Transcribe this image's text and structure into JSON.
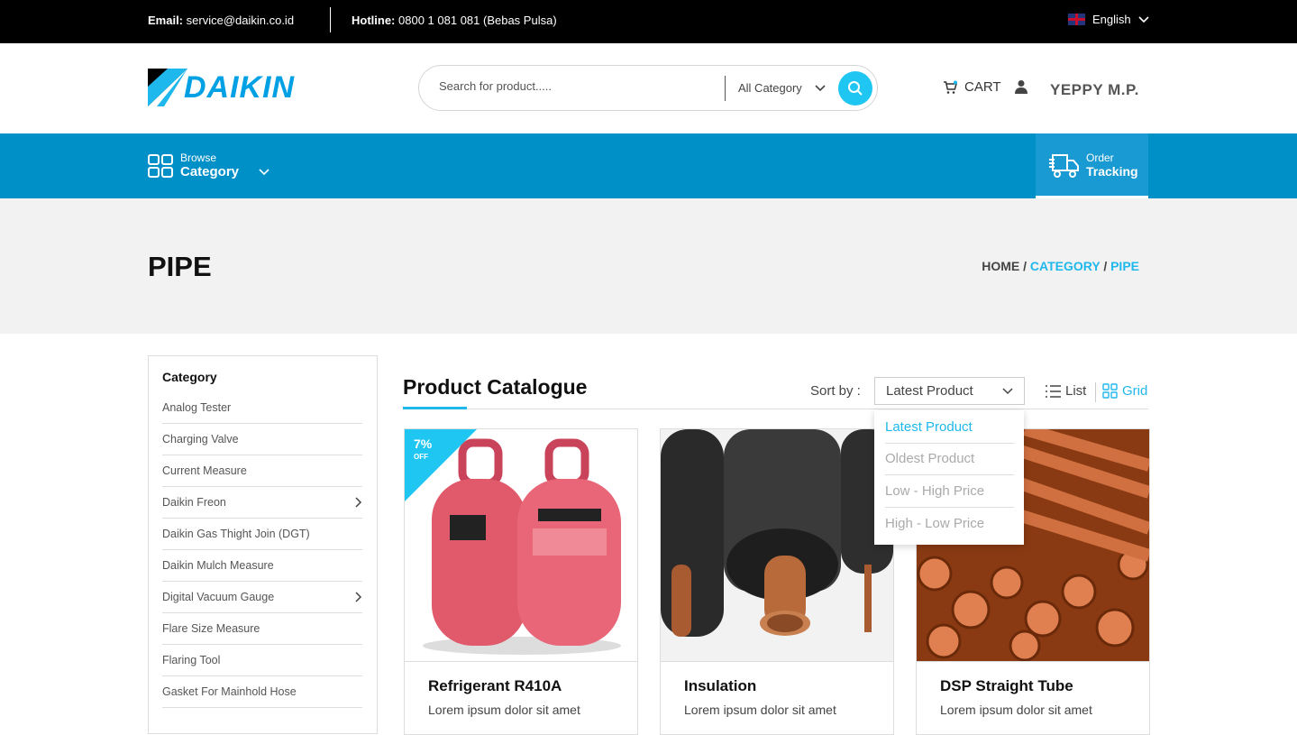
{
  "topbar": {
    "email_label": "Email:",
    "email_value": "service@daikin.co.id",
    "hotline_label": "Hotline:",
    "hotline_value": "0800 1 081 081 (Bebas Pulsa)",
    "language": "English"
  },
  "header": {
    "logo_text": "DAIKIN",
    "search_placeholder": "Search for product.....",
    "category_select": "All Category",
    "cart_label": "CART",
    "username": "YEPPY M.P."
  },
  "nav": {
    "browse_small": "Browse",
    "browse_big": "Category",
    "tracking_small": "Order",
    "tracking_big": "Tracking"
  },
  "page": {
    "title": "PIPE",
    "breadcrumb": {
      "home": "HOME",
      "sep": "/",
      "category": "CATEGORY",
      "current": "PIPE"
    }
  },
  "sidebar": {
    "title": "Category",
    "items": [
      {
        "label": "Analog Tester",
        "has_children": false
      },
      {
        "label": "Charging Valve",
        "has_children": false
      },
      {
        "label": "Current Measure",
        "has_children": false
      },
      {
        "label": "Daikin Freon",
        "has_children": true
      },
      {
        "label": "Daikin Gas Thight Join (DGT)",
        "has_children": false
      },
      {
        "label": "Daikin Mulch Measure",
        "has_children": false
      },
      {
        "label": "Digital Vacuum Gauge",
        "has_children": true
      },
      {
        "label": "Flare Size Measure",
        "has_children": false
      },
      {
        "label": "Flaring Tool",
        "has_children": false
      },
      {
        "label": "Gasket For Mainhold Hose",
        "has_children": false
      }
    ]
  },
  "catalogue": {
    "title": "Product Catalogue",
    "sort_label": "Sort by :",
    "sort_selected": "Latest Product",
    "view_list": "List",
    "view_grid": "Grid",
    "sort_options": [
      "Latest Product",
      "Oldest Product",
      "Low - High Price",
      "High - Low Price"
    ]
  },
  "products": [
    {
      "name": "Refrigerant R410A",
      "desc": "Lorem ipsum dolor sit amet",
      "badge_pct": "7%",
      "badge_off": "OFF"
    },
    {
      "name": "Insulation",
      "desc": "Lorem ipsum dolor sit amet"
    },
    {
      "name": "DSP Straight Tube",
      "desc": "Lorem ipsum dolor sit amet"
    }
  ],
  "colors": {
    "accent": "#1fb8ec",
    "nav": "#0090c8",
    "topbar": "#000000"
  },
  "icons": [
    "uk-flag-icon",
    "chevron-down-icon",
    "search-icon",
    "cart-icon",
    "user-icon",
    "grid-icon",
    "truck-icon",
    "list-icon",
    "chevron-right-icon"
  ]
}
